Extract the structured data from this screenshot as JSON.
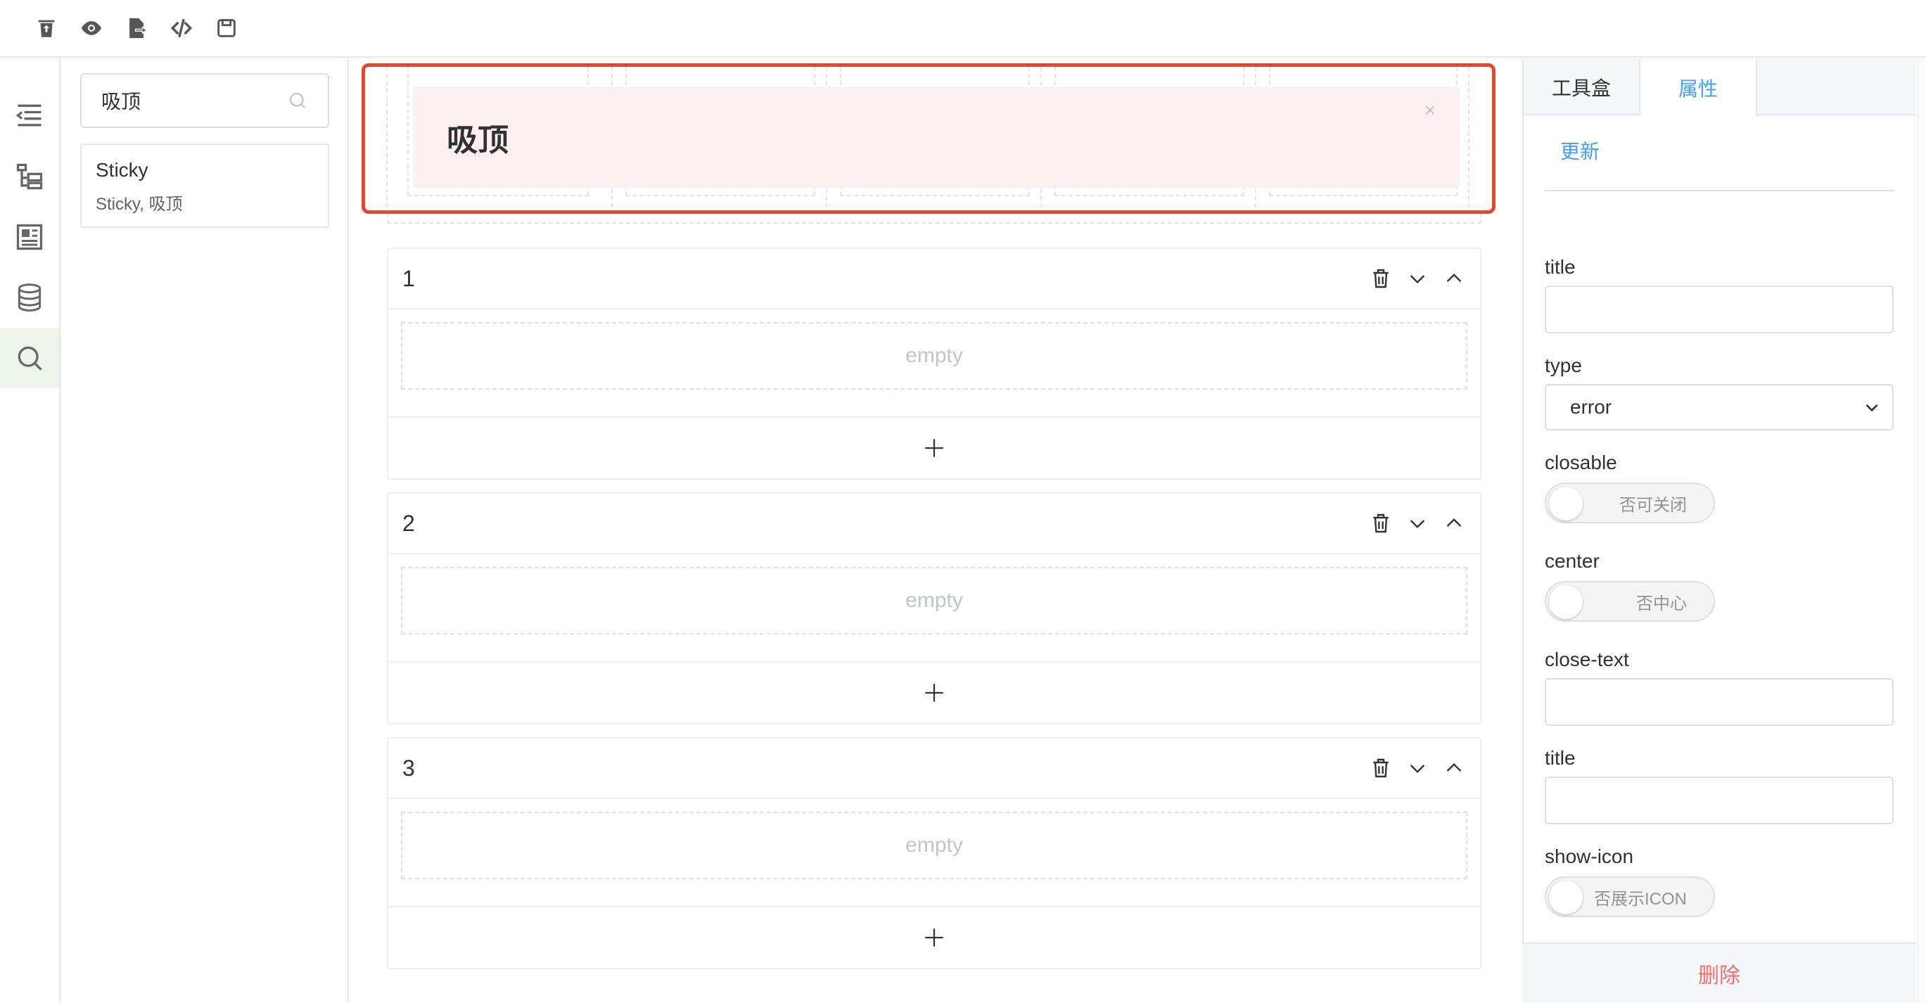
{
  "toolbar": {
    "icons": [
      "clear-icon",
      "preview-icon",
      "export-icon",
      "code-icon",
      "save-icon"
    ]
  },
  "rail": {
    "items": [
      "outline-icon",
      "tree-icon",
      "layout-icon",
      "database-icon",
      "search-icon"
    ],
    "active_index": 4
  },
  "component_panel": {
    "search_value": "吸顶",
    "results": [
      {
        "title": "Sticky",
        "subtitle": "Sticky, 吸顶"
      }
    ]
  },
  "canvas": {
    "sticky_alert": {
      "title": "吸顶",
      "close_glyph": "×"
    },
    "sections": [
      {
        "number": "1",
        "empty_text": "empty"
      },
      {
        "number": "2",
        "empty_text": "empty"
      },
      {
        "number": "3",
        "empty_text": "empty"
      }
    ]
  },
  "properties": {
    "tabs": [
      {
        "label": "工具盒",
        "active": false
      },
      {
        "label": "属性",
        "active": true
      }
    ],
    "update_label": "更新",
    "fields": {
      "title_label": "title",
      "title_value": "",
      "type_label": "type",
      "type_value": "error",
      "closable_label": "closable",
      "closable_text": "否可关闭",
      "closable_on": false,
      "center_label": "center",
      "center_text": "否中心",
      "center_on": false,
      "close_text_label": "close-text",
      "close_text_value": "",
      "title2_label": "title",
      "title2_value": "",
      "show_icon_label": "show-icon",
      "show_icon_text": "否展示ICON",
      "show_icon_on": false
    },
    "delete_label": "删除"
  },
  "colors": {
    "accent": "#409eff",
    "selection_border": "#e2482e",
    "alert_bg": "#fdf0f0",
    "danger": "#f56c6c"
  }
}
